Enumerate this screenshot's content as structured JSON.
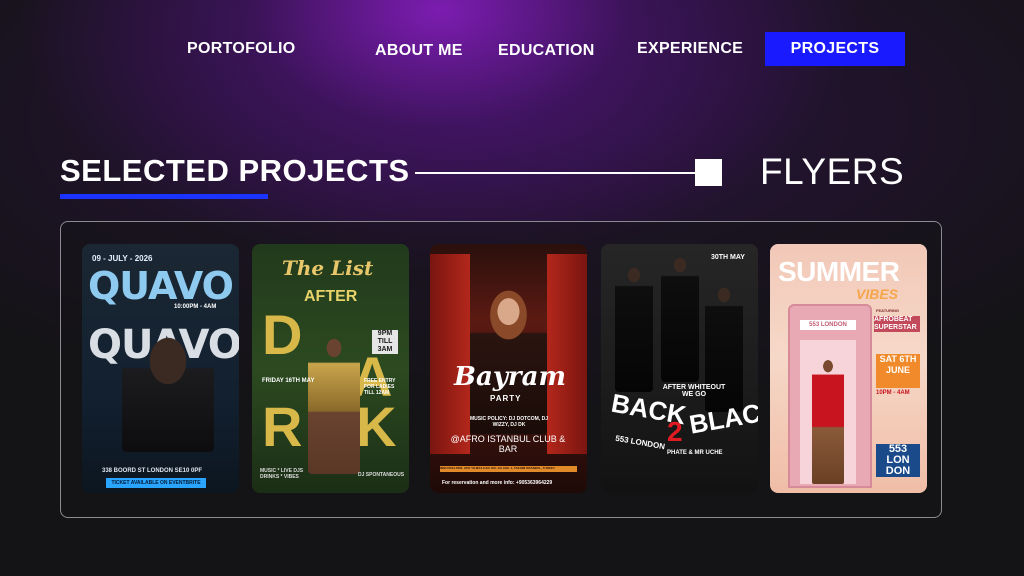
{
  "nav": {
    "portfolio": "PORTOFOLIO",
    "about": "ABOUT ME",
    "education": "EDUCATION",
    "experience": "EXPERIENCE",
    "projects": "PROJECTS",
    "active": "PROJECTS",
    "active_color": "#1a1aff"
  },
  "section": {
    "title": "SELECTED PROJECTS",
    "category": "FLYERS",
    "underline_color": "#1a33ff"
  },
  "flyers": [
    {
      "date": "09 - JULY - 2026",
      "headline_1": "QUAVO",
      "headline_2": "QUAVO",
      "time": "10:00PM - 4AM",
      "address": "338 BOORD ST LONDON SE10 0PF",
      "ticket": "TICKET AVAILABLE ON EVENTBRITE"
    },
    {
      "script": "The List",
      "after": "AFTER",
      "letters": [
        "D",
        "A",
        "R",
        "K"
      ],
      "day": "FRIDAY 16TH MAY",
      "free_entry": "FREE ENTRY FOR LADIES TILL 12AM",
      "time": "9PM TILL 3AM",
      "music": "MUSIC * LIVE DJS DRINKS * VIBES",
      "dj": "DJ SPONTANEOUS"
    },
    {
      "title": "Bayram",
      "subtitle": "PARTY",
      "music": "MUSIC POLICY: DJ DOTCOM, DJ WIZZY, DJ DK",
      "club": "@AFRO ISTANBUL CLUB & BAR",
      "address_strip": "INIZI PASA PER. ATIF YILMAZ CAD. NO. 1/A ASS. 1, TAKSIM ISTANBUL, TURKEY",
      "reservation": "For reservation and more info: +905363964229"
    },
    {
      "date": "30TH MAY",
      "tagline": "AFTER WHITEOUT WE GO",
      "back": "BACK",
      "two": "2",
      "black": "BLACK",
      "venue": "553 LONDON",
      "host": "PHATE & MR UCHE"
    },
    {
      "summer": "SUMMER",
      "vibes": "VIBES",
      "booth_sign": "553 LONDON",
      "featuring": "FEATURING",
      "artist": "AFROBEAT SUPERSTAR",
      "date": "SAT 6TH JUNE",
      "time": "10PM - 4AM",
      "venue": "553 LON DON"
    }
  ]
}
